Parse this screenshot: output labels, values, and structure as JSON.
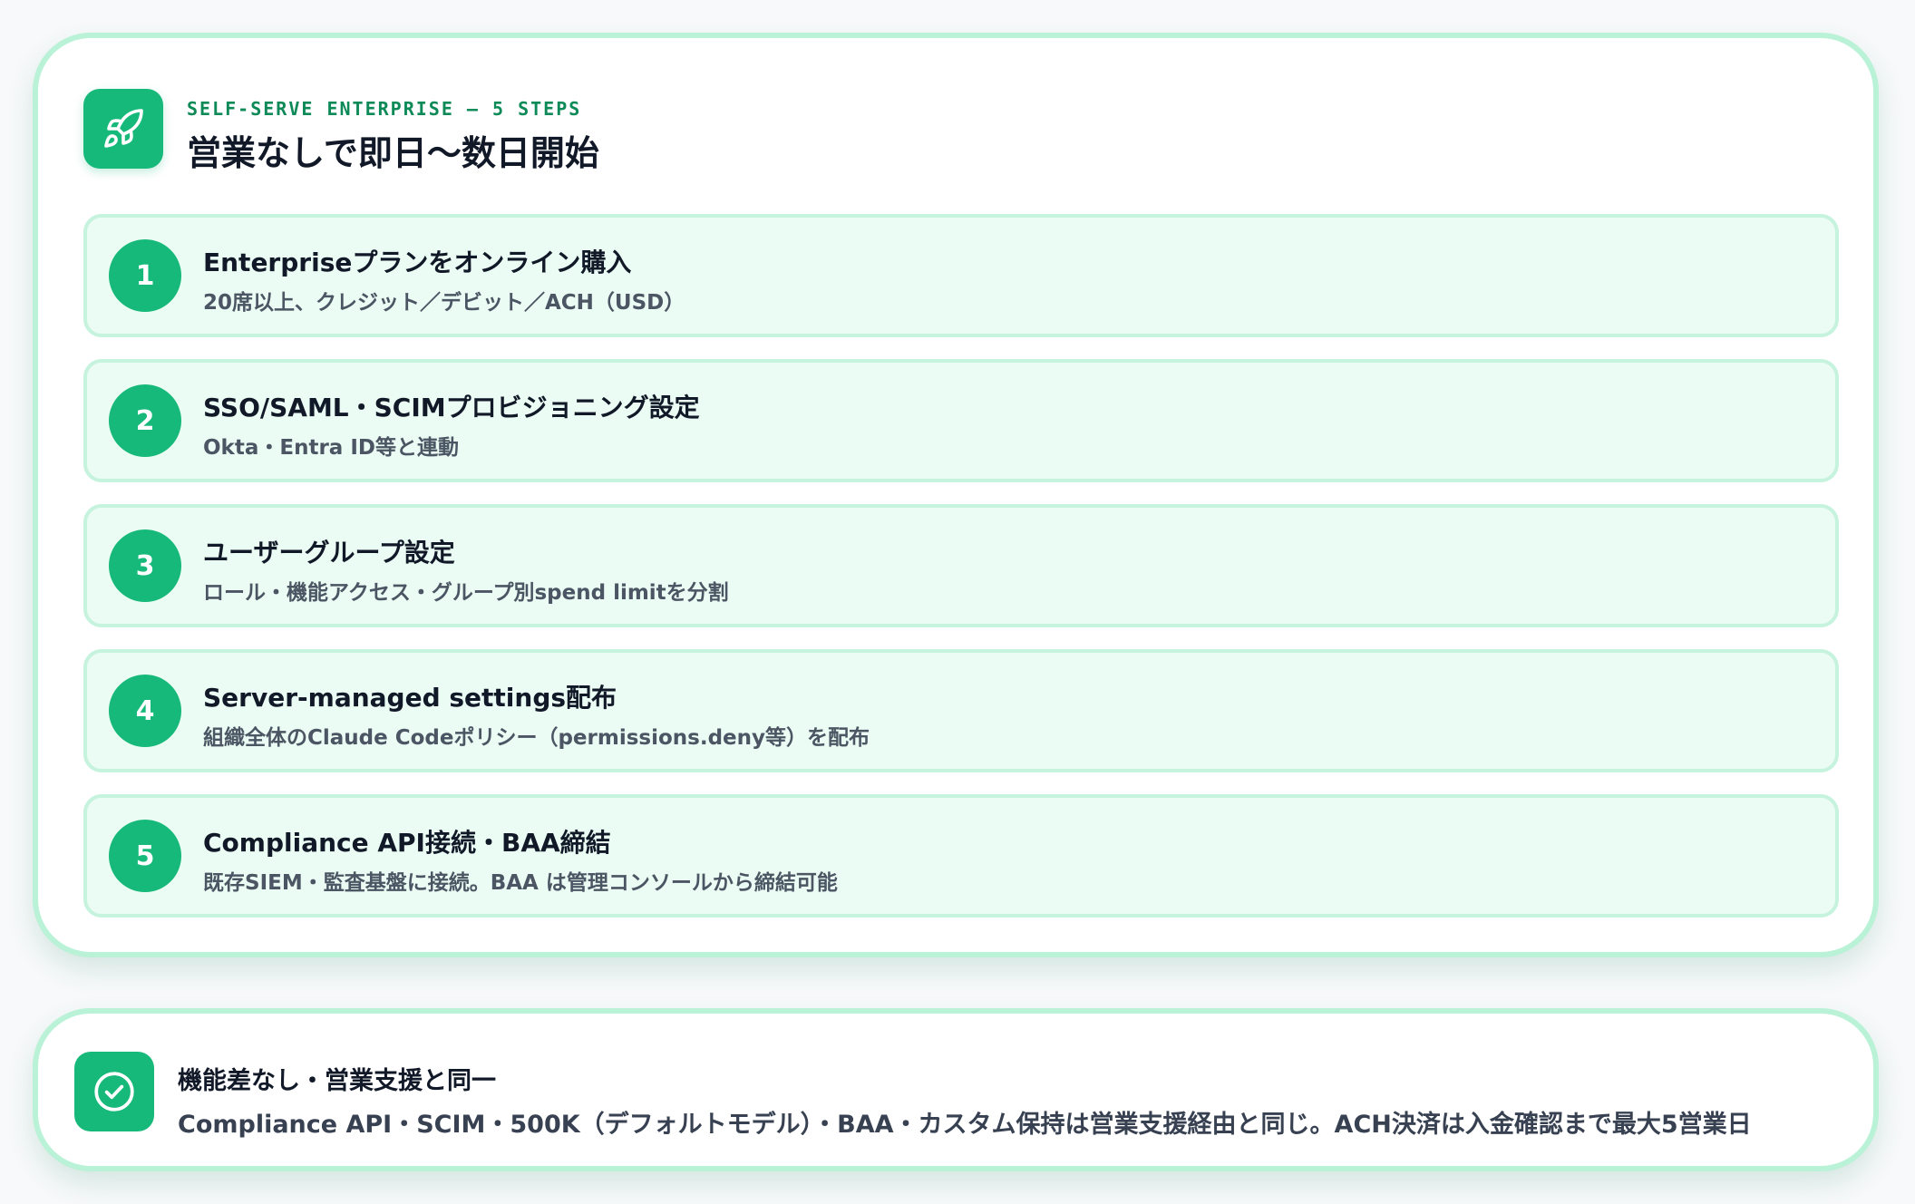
{
  "header": {
    "eyebrow": "SELF-SERVE ENTERPRISE — 5 STEPS",
    "title": "営業なしで即日〜数日開始",
    "icon": "rocket-icon"
  },
  "steps": [
    {
      "number": "1",
      "title": "Enterpriseプランをオンライン購入",
      "description": "20席以上、クレジット／デビット／ACH（USD）"
    },
    {
      "number": "2",
      "title": "SSO/SAML・SCIMプロビジョニング設定",
      "description": "Okta・Entra ID等と連動"
    },
    {
      "number": "3",
      "title": "ユーザーグループ設定",
      "description": "ロール・機能アクセス・グループ別spend limitを分割"
    },
    {
      "number": "4",
      "title": "Server-managed settings配布",
      "description": "組織全体のClaude Codeポリシー（permissions.deny等）を配布"
    },
    {
      "number": "5",
      "title": "Compliance API接続・BAA締結",
      "description": "既存SIEM・監査基盤に接続。BAA は管理コンソールから締結可能"
    }
  ],
  "note": {
    "icon": "check-circle-icon",
    "title": "機能差なし・営業支援と同一",
    "text": "Compliance API・SCIM・500K（デフォルトモデル）・BAA・カスタム保持は営業支援経由と同じ。ACH決済は入金確認まで最大5営業日"
  },
  "colors": {
    "accent": "#16b97a",
    "accent_dark": "#0d8a57",
    "card_border": "#b9f2d6",
    "step_background": "#eafcf3",
    "step_border": "#c6f3dd"
  }
}
